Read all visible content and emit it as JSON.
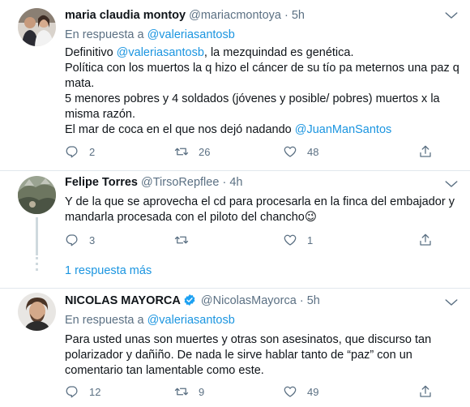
{
  "tweets": [
    {
      "name": "maria claudia montoy",
      "handle": "@mariacmontoya",
      "separator": "·",
      "time": "5h",
      "reply_prefix": "En respuesta a",
      "reply_handle": "@valeriasantosb",
      "text_lines": [
        "Definitivo ",
        "@valeriasantosb",
        ", la mezquindad es genética.",
        "Política con los muertos la q hizo el cáncer de su tío pa meternos una paz q mata.",
        "5 menores pobres y 4 soldados (jóvenes y posible/ pobres) muertos x la misma razón.",
        "El mar de coca en el que nos dejó nadando ",
        "@JuanManSantos"
      ],
      "replies": "2",
      "retweets": "26",
      "likes": "48"
    },
    {
      "name": "Felipe Torres",
      "handle": "@TirsoRepflee",
      "separator": "·",
      "time": "4h",
      "text": "Y de la que se aprovecha el cd para procesarla en la finca del embajador y mandarla procesada con el piloto del chancho",
      "emoji": "😉",
      "replies": "3",
      "retweets": "",
      "likes": "1"
    },
    {
      "name": "NICOLAS MAYORCA",
      "handle": "@NicolasMayorca",
      "separator": "·",
      "time": "5h",
      "reply_prefix": "En respuesta a",
      "reply_handle": "@valeriasantosb",
      "text": "Para usted unas son muertes y otras son asesinatos, que discurso tan polarizador y dañiño. De nada le sirve hablar tanto de “paz” con un comentario tan lamentable como este.",
      "replies": "12",
      "retweets": "9",
      "likes": "49"
    }
  ],
  "more_replies_label": "1 respuesta más",
  "colors": {
    "link": "#1b95e0",
    "muted": "#5b7083",
    "verified": "#1da1f2",
    "thread_line": "#cfd9de"
  },
  "icons": [
    "reply-icon",
    "retweet-icon",
    "like-icon",
    "share-icon",
    "more-icon",
    "verified-badge-icon"
  ]
}
